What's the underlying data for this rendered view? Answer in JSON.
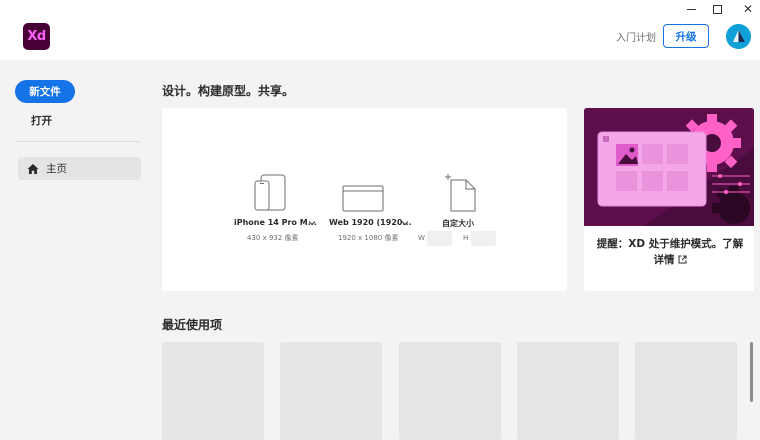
{
  "app": {
    "logo_text": "Xd",
    "brand_color": "#470137",
    "logo_accent": "#ff61f6"
  },
  "window_controls": {
    "minimize_icon": "minimize-icon",
    "maximize_icon": "maximize-icon",
    "close_icon": "close-icon",
    "close_glyph": "✕"
  },
  "header": {
    "learn_link": "入门计划",
    "upgrade_label": "升级",
    "accent_color": "#1473e6"
  },
  "sidebar": {
    "new_file_label": "新文件",
    "open_label": "打开",
    "items": [
      {
        "label": "主页",
        "icon": "home-icon",
        "selected": true
      }
    ]
  },
  "main": {
    "hero_title": "设计。构建原型。共享。",
    "presets": [
      {
        "name": "iPhone 14 Pro M...",
        "size": "430 x 932 像素",
        "icon": "iphone-icon",
        "has_dropdown": true
      },
      {
        "name": "Web 1920 (1920...",
        "size": "1920 x 1080 像素",
        "icon": "web-icon",
        "has_dropdown": true
      },
      {
        "name": "自定大小",
        "icon": "custom-size-icon",
        "width_label": "W",
        "height_label": "H",
        "width_value": "",
        "height_value": ""
      }
    ],
    "promo": {
      "text": "提醒：XD 处于维护模式。了解详情",
      "icon": "external-link-icon"
    },
    "recent_title": "最近使用项",
    "recent_tiles_count": 5
  }
}
